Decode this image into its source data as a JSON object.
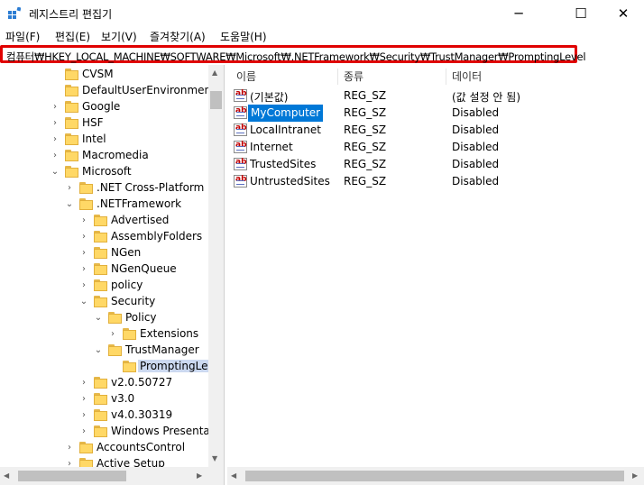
{
  "window": {
    "title": "레지스트리 편집기",
    "minimize": "─",
    "maximize": "☐",
    "close": "✕"
  },
  "menu": [
    "파일(F)",
    "편집(E)",
    "보기(V)",
    "즐겨찾기(A)",
    "도움말(H)"
  ],
  "address": "컴퓨터₩HKEY_LOCAL_MACHINE₩SOFTWARE₩Microsoft₩.NETFramework₩Security₩TrustManager₩PromptingLevel",
  "tree": [
    {
      "label": "CVSM",
      "chev": ""
    },
    {
      "label": "DefaultUserEnvironment",
      "chev": ""
    },
    {
      "label": "Google",
      "chev": ">"
    },
    {
      "label": "HSF",
      "chev": ">"
    },
    {
      "label": "Intel",
      "chev": ">"
    },
    {
      "label": "Macromedia",
      "chev": ">"
    },
    {
      "label": "Microsoft",
      "chev": "v"
    },
    {
      "label": ".NET Cross-Platform",
      "chev": ">"
    },
    {
      "label": ".NETFramework",
      "chev": "v"
    },
    {
      "label": "Advertised",
      "chev": ">"
    },
    {
      "label": "AssemblyFolders",
      "chev": ">"
    },
    {
      "label": "NGen",
      "chev": ">"
    },
    {
      "label": "NGenQueue",
      "chev": ">"
    },
    {
      "label": "policy",
      "chev": ">"
    },
    {
      "label": "Security",
      "chev": "v"
    },
    {
      "label": "Policy",
      "chev": "v"
    },
    {
      "label": "Extensions",
      "chev": ">"
    },
    {
      "label": "TrustManager",
      "chev": "v"
    },
    {
      "label": "PromptingLevel",
      "chev": ""
    },
    {
      "label": "v2.0.50727",
      "chev": ">"
    },
    {
      "label": "v3.0",
      "chev": ">"
    },
    {
      "label": "v4.0.30319",
      "chev": ">"
    },
    {
      "label": "Windows Presentation",
      "chev": ">"
    },
    {
      "label": "AccountsControl",
      "chev": ">"
    },
    {
      "label": "Active Setup",
      "chev": ">"
    }
  ],
  "columns": {
    "name": "이름",
    "type": "종류",
    "data": "데이터"
  },
  "values": [
    {
      "name": "(기본값)",
      "type": "REG_SZ",
      "data": "(값 설정 안 됨)"
    },
    {
      "name": "MyComputer",
      "type": "REG_SZ",
      "data": "Disabled"
    },
    {
      "name": "LocalIntranet",
      "type": "REG_SZ",
      "data": "Disabled"
    },
    {
      "name": "Internet",
      "type": "REG_SZ",
      "data": "Disabled"
    },
    {
      "name": "TrustedSites",
      "type": "REG_SZ",
      "data": "Disabled"
    },
    {
      "name": "UntrustedSites",
      "type": "REG_SZ",
      "data": "Disabled"
    }
  ],
  "icons": {
    "app": "registry-editor-icon",
    "string_value": "string-value-icon",
    "folder": "folder-icon"
  },
  "colors": {
    "highlight": "#e00000",
    "selection": "#0078d7"
  }
}
